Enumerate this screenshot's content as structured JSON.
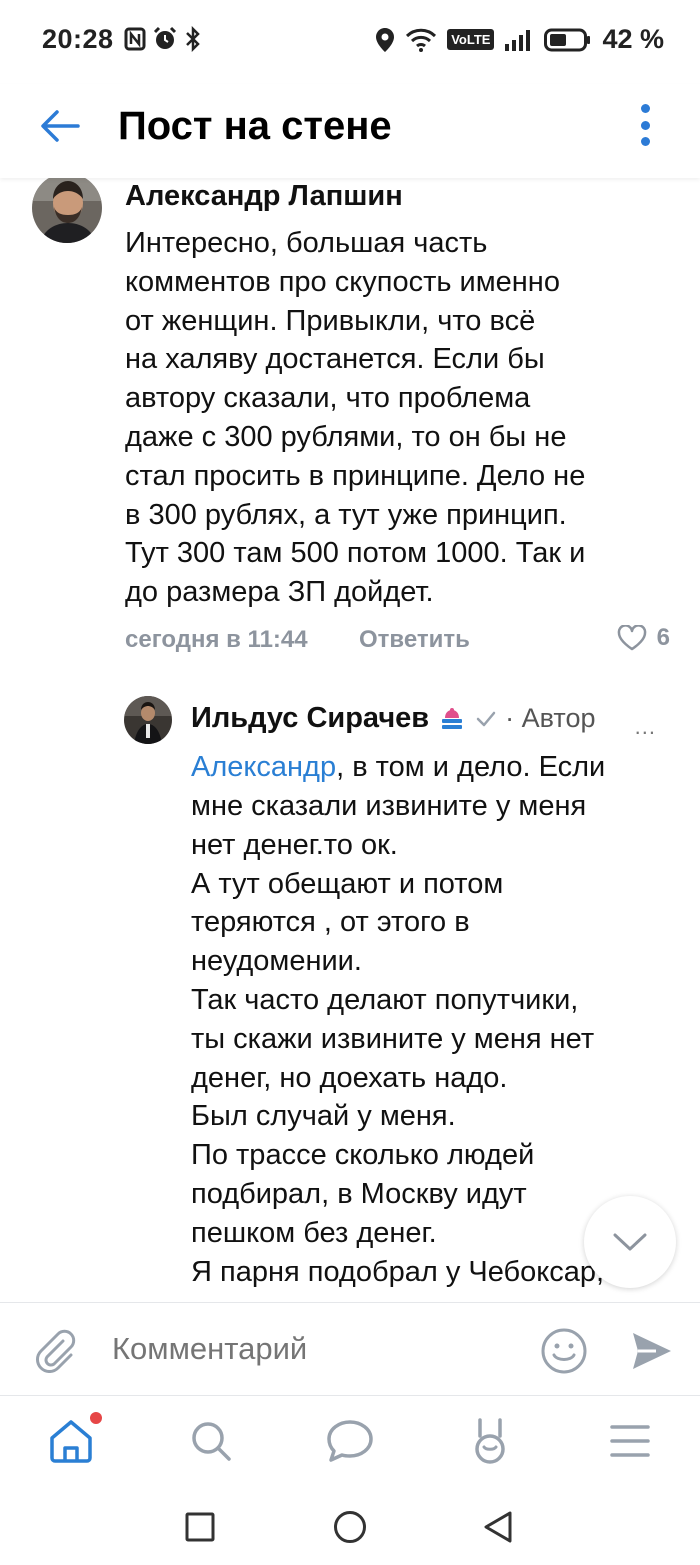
{
  "status_bar": {
    "time": "20:28",
    "battery_percent": "42 %",
    "network_label": "VoLTE"
  },
  "header": {
    "title": "Пост на стене"
  },
  "comment": {
    "author": "Александр Лапшин",
    "text": "Интересно, большая часть\nкомментов про скупость именно\nот женщин. Привыкли, что всё\nна халяву достанется.  Если бы\nавтору сказали, что проблема\nдаже с 300 рублями, то он бы не\nстал просить в принципе. Дело не\nв 300 рублях, а тут уже принцип.\nТут 300 там 500 потом 1000. Так и\nдо размера ЗП дойдет.",
    "time": "сегодня в 11:44",
    "reply_label": "Ответить",
    "likes": "6"
  },
  "reply": {
    "author": "Ильдус Сирачев",
    "author_tag": "· Автор",
    "more": "...",
    "mention": "Александр",
    "text_first_line_rest": ", в том и дело. Если",
    "text": "мне сказали извините у меня\nнет денег.то ок.\nА тут обещают и потом\nтеряются , от этого в\nнеудомении.\nТак часто делают попутчики,\nты скажи извините у меня нет\nденег, но доехать надо.\nБыл случай у меня.\nПо трассе сколько людей\nподбирал, в Москву идут\nпешком без денег.\nЯ парня подобрал у Чебоксар,"
  },
  "composer": {
    "placeholder": "Комментарий"
  },
  "colors": {
    "accent": "#2a7fd4",
    "meta": "#8d949e",
    "notification": "#e64646"
  }
}
